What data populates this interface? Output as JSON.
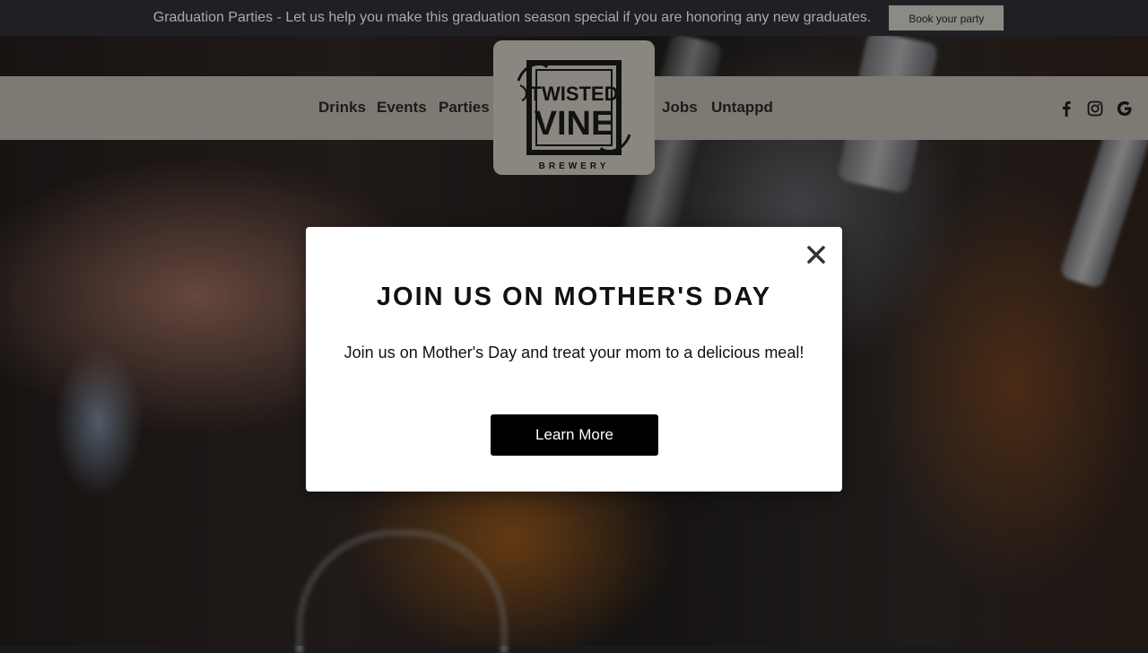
{
  "announcement": {
    "text": "Graduation Parties - Let us help you make this graduation season special if you are honoring any new graduates.",
    "button_label": "Book your party"
  },
  "nav": {
    "left": [
      "Drinks",
      "Events",
      "Parties"
    ],
    "right": [
      "Jobs",
      "Untappd"
    ]
  },
  "logo": {
    "line1": "TWISTED",
    "line2": "VINE",
    "line3": "BREWERY"
  },
  "social": {
    "icons": [
      "facebook-icon",
      "instagram-icon",
      "google-icon"
    ]
  },
  "modal": {
    "title": "JOIN US ON MOTHER'S DAY",
    "body": "Join us on Mother's Day and treat your mom to a delicious meal!",
    "button_label": "Learn More",
    "close_icon": "close-icon"
  },
  "colors": {
    "announcement_bg": "#1f2023",
    "nav_bg": "#7d7a73",
    "modal_button": "#000000"
  }
}
